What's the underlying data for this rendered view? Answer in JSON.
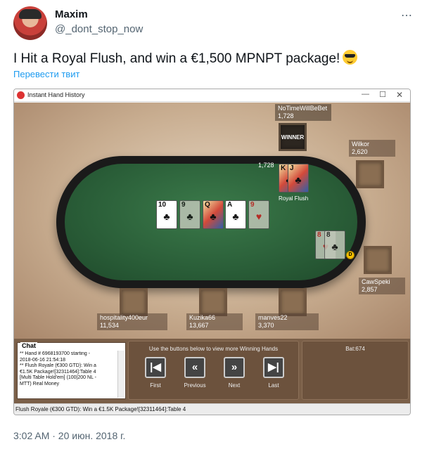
{
  "tweet": {
    "author_name": "Maxim",
    "author_handle": "@_dont_stop_now",
    "more_icon": "⋯",
    "text": "I Hit a Royal Flush, and win a €1,500 MPNPT package!",
    "translate_link": "Перевести твит",
    "timestamp": "3:02 AM · 20 июн. 2018 г."
  },
  "window": {
    "title": "Instant Hand History",
    "minimize": "—",
    "maximize": "☐",
    "close": "✕"
  },
  "players": [
    {
      "name": "NoTimeWillBeBet",
      "stack": "1,728"
    },
    {
      "name": "Wilkor",
      "stack": "2,620"
    },
    {
      "name": "CawSpeki",
      "stack": "2,857"
    },
    {
      "name": "manves22",
      "stack": "3,370"
    },
    {
      "name": "Kuzika66",
      "stack": "13,667"
    },
    {
      "name": "hospitality400eur",
      "stack": "11,534"
    }
  ],
  "winner_label": "WINNER",
  "bet_amount": "1,728",
  "hand_label": "Royal Flush",
  "dealer_label": "D",
  "board": [
    {
      "rank": "10",
      "suit": "♣",
      "color": "black",
      "dim": false
    },
    {
      "rank": "9",
      "suit": "♣",
      "color": "black",
      "dim": true
    },
    {
      "rank": "Q",
      "suit": "♣",
      "color": "black",
      "dim": false
    },
    {
      "rank": "A",
      "suit": "♣",
      "color": "black",
      "dim": false
    },
    {
      "rank": "9",
      "suit": "♥",
      "color": "red",
      "dim": true
    }
  ],
  "winner_hole": [
    {
      "rank": "K",
      "suit": "♣",
      "color": "black"
    },
    {
      "rank": "J",
      "suit": "♣",
      "color": "black"
    }
  ],
  "other_hole": [
    {
      "rank": "8",
      "suit": "♥",
      "color": "red"
    },
    {
      "rank": "8",
      "suit": "♣",
      "color": "black"
    }
  ],
  "chat": {
    "title": "Chat",
    "lines": [
      "** Hand # 6968193700 starting -",
      "2018-06-16 21:54:18",
      "** Flush Royale (€300 GTD): Win a",
      "€1.5K Package![32311464]:Table 4",
      "[Multi Table Hold'em] (100|200 NL -",
      "MTT) Real Money"
    ]
  },
  "nav": {
    "hint": "Use the buttons below to view more Winning Hands",
    "buttons": [
      {
        "label": "First",
        "glyph": "|◀"
      },
      {
        "label": "Previous",
        "glyph": "«"
      },
      {
        "label": "Next",
        "glyph": "»"
      },
      {
        "label": "Last",
        "glyph": "▶|"
      }
    ]
  },
  "bat": "Bat:674",
  "status_bar": "Flush Royale (€300 GTD): Win a €1.5K Package![32311464]:Table 4"
}
